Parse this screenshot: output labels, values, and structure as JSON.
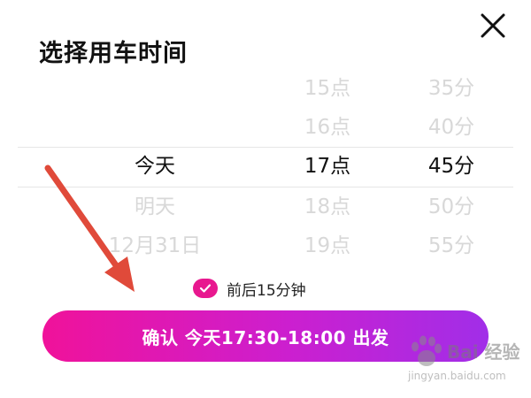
{
  "title": "选择用车时间",
  "picker": {
    "day": [
      "",
      "",
      "今天",
      "明天",
      "12月31日"
    ],
    "hour": [
      "15点",
      "16点",
      "17点",
      "18点",
      "19点"
    ],
    "minute": [
      "35分",
      "40分",
      "45分",
      "50分",
      "55分"
    ],
    "selected_index": 2
  },
  "flex_option": {
    "label": "前后15分钟",
    "checked": true
  },
  "confirm": {
    "label": "确认 今天17:30-18:00 出发"
  },
  "watermark": {
    "text": "Bai 经验",
    "sub": "jingyan.baidu.com"
  },
  "colors": {
    "accent": "#e8188f",
    "gradient_start": "#f0129a",
    "gradient_end": "#a12ee8",
    "arrow": "#e04a3a"
  },
  "icons": [
    "close-icon",
    "check-icon",
    "annotation-arrow-icon",
    "baidu-paw-icon"
  ]
}
